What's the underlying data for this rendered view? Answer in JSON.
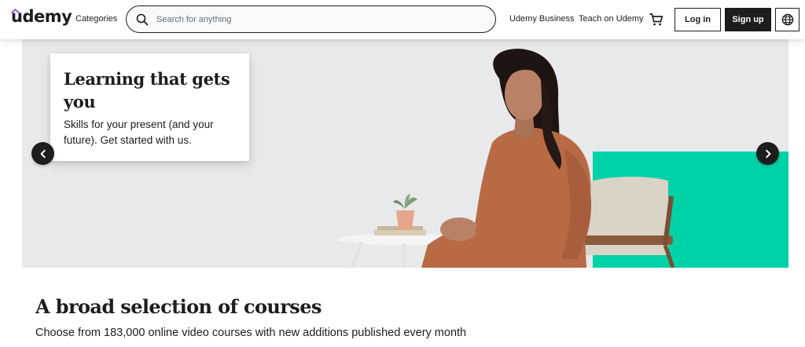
{
  "header": {
    "logo_text": "udemy",
    "categories_label": "Categories",
    "search": {
      "placeholder": "Search for anything",
      "value": ""
    },
    "nav": {
      "business": "Udemy Business",
      "teach": "Teach on Udemy"
    },
    "login_label": "Log in",
    "signup_label": "Sign up",
    "icons": {
      "search": "search-icon",
      "cart": "cart-icon",
      "language": "globe-icon"
    },
    "colors": {
      "brand_purple": "#a435f0",
      "text": "#1c1d1f",
      "search_bg": "#f7f9fa"
    }
  },
  "hero": {
    "title": "Learning that gets you",
    "subtitle": "Skills for your present (and your future). Get started with us.",
    "colors": {
      "background": "#e8e9eb",
      "accent_teal": "#00d2a8",
      "dress": "#b86a45"
    },
    "controls": {
      "prev_icon": "chevron-left-icon",
      "next_icon": "chevron-right-icon"
    }
  },
  "section": {
    "title": "A broad selection of courses",
    "subtitle": "Choose from 183,000 online video courses with new additions published every month"
  }
}
